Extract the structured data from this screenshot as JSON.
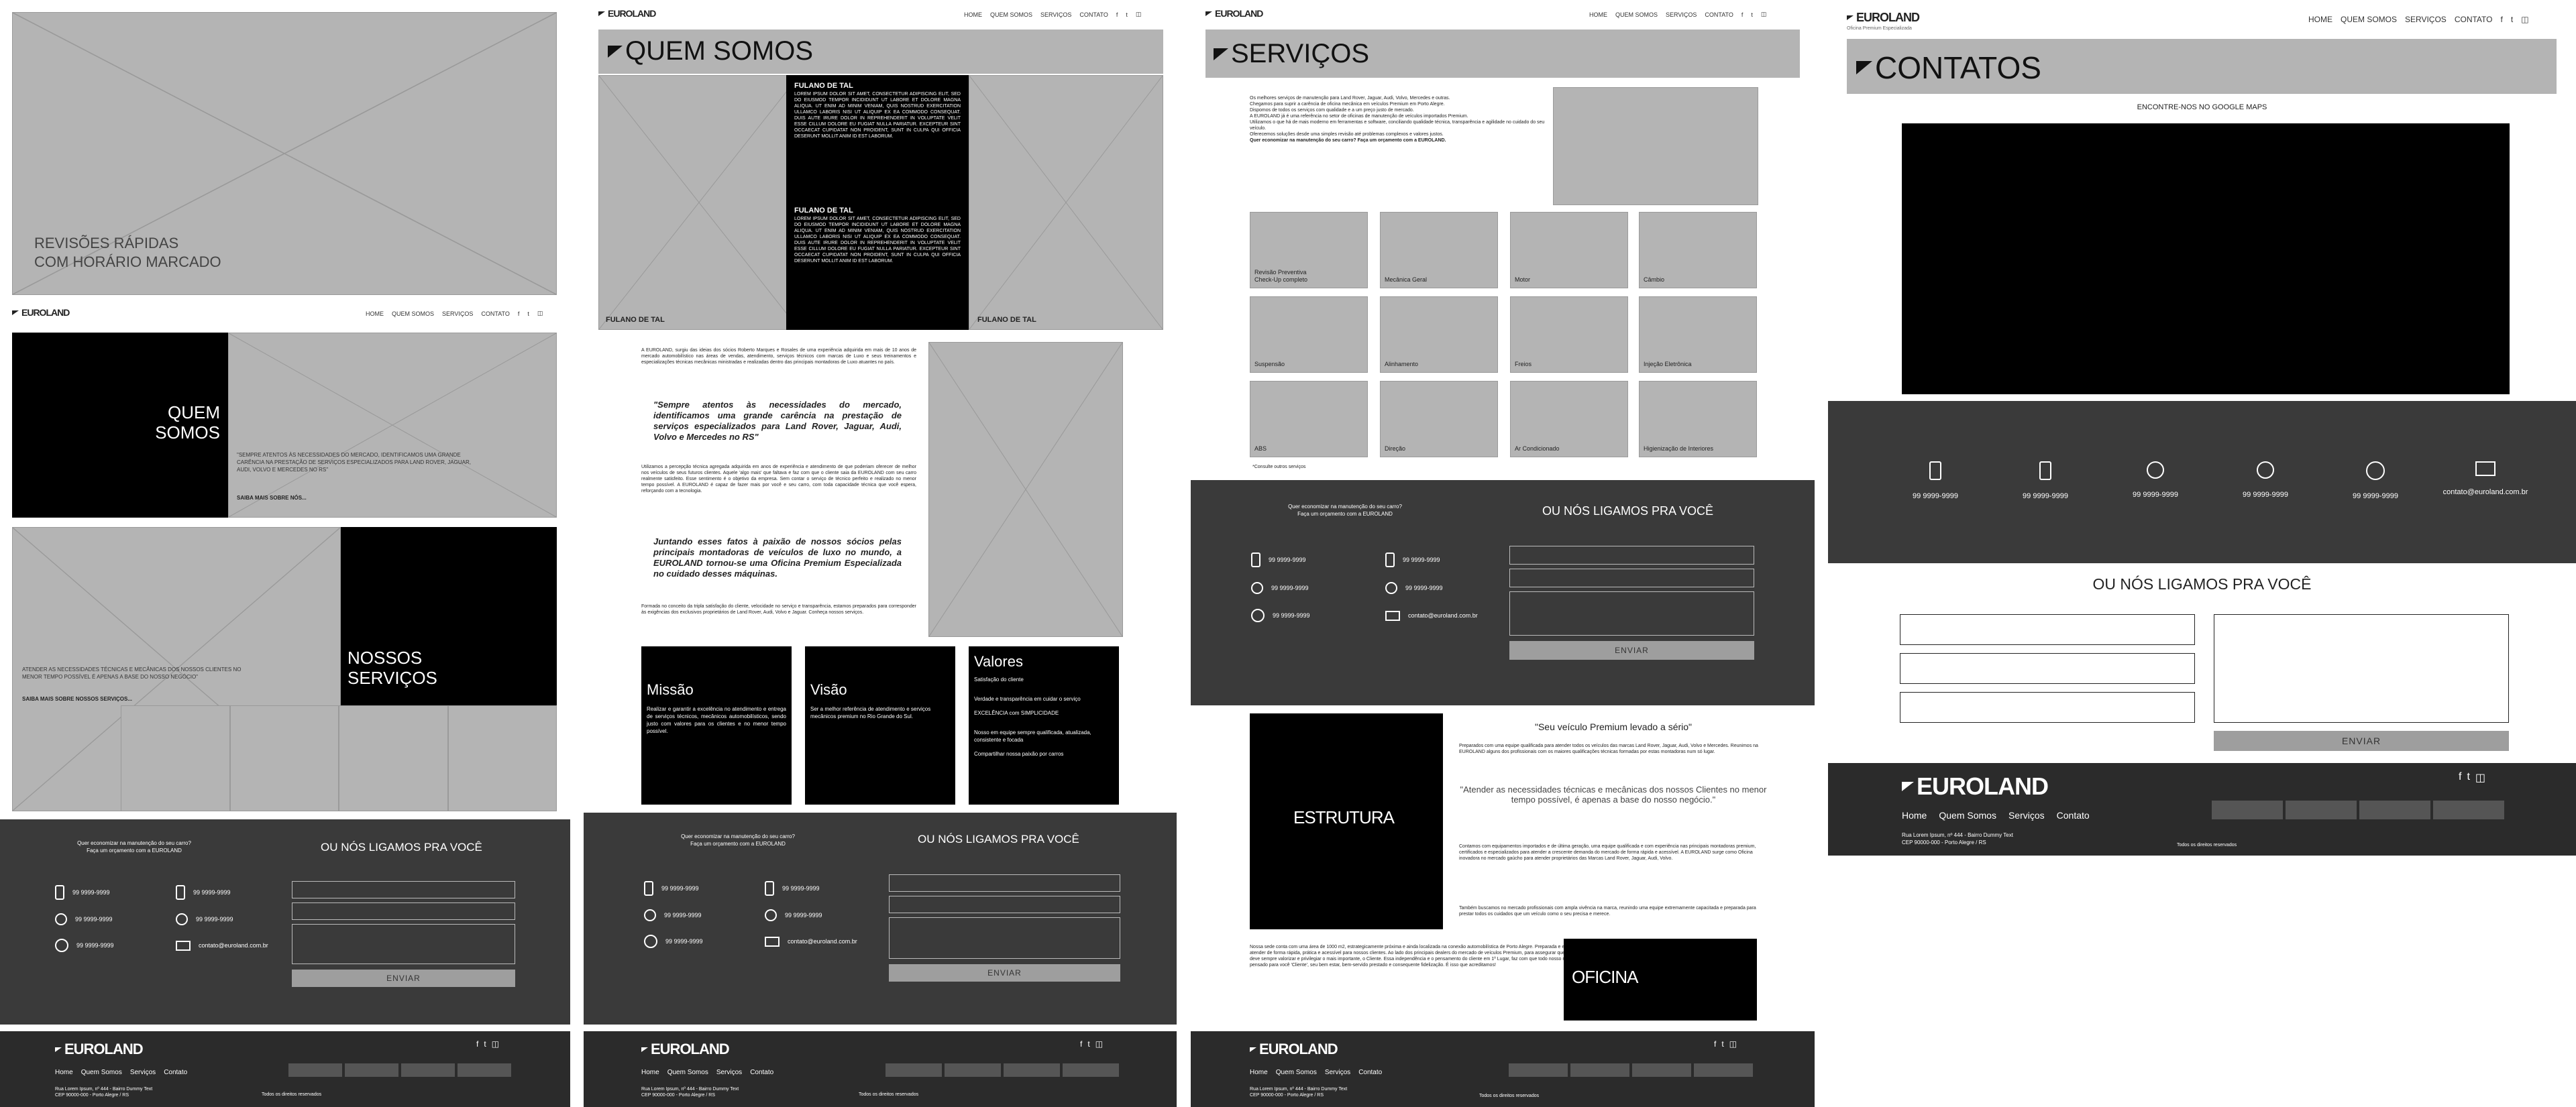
{
  "brand": {
    "name": "EUROLAND",
    "tagline": "Oficina Premium Especializada"
  },
  "nav": {
    "home": "HOME",
    "about": "QUEM SOMOS",
    "services": "SERVIÇOS",
    "contact": "CONTATO"
  },
  "footer_nav": {
    "home": "Home",
    "about": "Quem Somos",
    "services": "Serviços",
    "contact": "Contato"
  },
  "footer": {
    "address1": "Rua Lorem Ipsum, nº 444 - Bairro Dummy Text",
    "address2": "CEP 90000-000 - Porto Alegre / RS",
    "rights": "Todos os direitos reservados"
  },
  "home": {
    "hero_text": "REVISÕES RÁPIDAS\nCOM HORÁRIO MARCADO",
    "about_title": "QUEM\nSOMOS",
    "about_quote": "\"SEMPRE ATENTOS ÀS NECESSIDADES DO MERCADO, IDENTIFICAMOS UMA GRANDE CARÊNCIA NA PRESTAÇÃO DE SERVIÇOS ESPECIALIZADOS PARA LAND ROVER, JAGUAR, AUDI, VOLVO E MERCEDES NO RS\"",
    "about_more": "SAIBA MAIS SOBRE NÓS...",
    "services_title": "NOSSOS\nSERVIÇOS",
    "services_text": "ATENDER AS NECESSIDADES TÉCNICAS E MECÂNICAS DOS NOSSOS CLIENTES NO MENOR TEMPO POSSÍVEL É APENAS A BASE DO NOSSO NEGÓCIO\"",
    "services_more": "SAIBA MAIS SOBRE NOSSOS SERVIÇOS..."
  },
  "callback": {
    "question1": "Quer economizar na manutenção do seu carro?",
    "question2": "Faça um orçamento com a EUROLAND",
    "title": "OU NÓS LIGAMOS PRA VOCÊ",
    "phone": "99 9999-9999",
    "email": "contato@euroland.com.br",
    "send": "ENVIAR"
  },
  "about": {
    "title": "QUEM SOMOS",
    "person_name": "FULANO DE TAL",
    "lorem": "LOREM IPSUM DOLOR SIT AMET, CONSECTETUR ADIPISCING ELIT, SED DO EIUSMOD TEMPOR INCIDIDUNT UT LABORE ET DOLORE MAGNA ALIQUA. UT ENIM AD MINIM VENIAM, QUIS NOSTRUD EXERCITATION ULLAMCO LABORIS NISI UT ALIQUIP EX EA COMMODO CONSEQUAT. DUIS AUTE IRURE DOLOR IN REPREHENDERIT IN VOLUPTATE VELIT ESSE CILLUM DOLORE EU FUGIAT NULLA PARIATUR. EXCEPTEUR SINT OCCAECAT CUPIDATAT NON PROIDENT, SUNT IN CULPA QUI OFFICIA DESERUNT MOLLIT ANIM ID EST LABORUM.",
    "intro": "A EUROLAND, surgiu das ideias dos sócios Roberto Marques e Rosales de uma experiência adquirida em mais de 10 anos de mercado automobilístico nas áreas de vendas, atendimento, serviços técnicos com marcas de Luxo e seus treinamentos e especializações técnicas mecânicas ministradas e realizadas dentro das principais montadoras de Luxo atuantes no país.",
    "quote1": "\"Sempre atentos às necessidades do mercado, identificamos uma grande carência na prestação de serviços especializados para Land Rover, Jaguar, Audi, Volvo e Mercedes no RS\"",
    "body": "Utilizamos a percepção técnica agregada adquirida em anos de experiência e atendimento de que poderiam oferecer de melhor nos veículos de seus futuros clientes. Aquele 'algo mais' que faltava e faz com que o cliente saia da EUROLAND com seu carro realmente satisfeito. Esse sentimento é o objetivo da empresa. Sem contar o serviço de técnico perfeito e realizado no menor tempo possível. A EUROLAND é capaz de fazer mais por você e seu carro, com toda capacidade técnica que você espera, reforçando com a tecnologia.",
    "quote2": "Juntando esses fatos à paixão de nossos sócios pelas principais montadoras de veículos de luxo no mundo, a EUROLAND tornou-se uma Oficina Premium Especializada no cuidado desses máquinas.",
    "closing": "Formada no conceito da tripla satisfação do cliente, velocidade no serviço e transparência, estamos preparados para corresponder às exigências dos exclusivos proprietários de Land Rover, Audi, Volvo e Jaguar. Conheça nossos serviços.",
    "mission_title": "Missão",
    "mission_text": "Realizar e garantir a excelência no atendimento e entrega de serviços técnicos, mecânicos automobilísticos, sendo justo com valores para os clientes e no menor tempo possível.",
    "vision_title": "Visão",
    "vision_text": "Ser a melhor referência de atendimento e serviços mecânicos premium no Rio Grande do Sul.",
    "values_title": "Valores",
    "values": [
      "Satisfação do cliente",
      "Verdade e transparência em cuidar o serviço",
      "EXCELÊNCIA com SIMPLICIDADE",
      "Nosso em equipe sempre qualificada, atualizada, consistente e focada",
      "Compartilhar nossa paixão por carros"
    ]
  },
  "services": {
    "title": "SERVIÇOS",
    "intro": [
      "Os melhores serviços de manutenção para Land Rover, Jaguar, Audi, Volvo, Mercedes e outras.",
      "Chegamos para suprir a carência de oficina mecânica em veículos Premium em Porto Alegre.",
      "Dispomos de todos os serviços com qualidade e a um preço justo de mercado.",
      "A EUROLAND já é uma referência no setor de oficinas de manutenção de veículos importados Premium.",
      "Utilizamos o que há de mais moderno em ferramentas e software, conciliando qualidade técnica, transparência e agilidade no cuidado do seu veículo.",
      "Oferecemos soluções desde uma simples revisão até problemas complexos e valores justos.",
      "Quer economizar na manutenção do seu carro? Faça um orçamento com a EUROLAND."
    ],
    "tiles": [
      "Revisão Preventiva\nCheck-Up completo",
      "Mecânica Geral",
      "Motor",
      "Câmbio",
      "Suspensão",
      "Alinhamento",
      "Freios",
      "Injeção Eletrônica",
      "ABS",
      "Direção",
      "Ar Condicionado",
      "Higienização de Interiores"
    ],
    "note": "*Consulte outros serviços",
    "structure_label": "ESTRUTURA",
    "workshop_label": "OFICINA",
    "quote1": "\"Seu veículo Premium levado a sério\"",
    "text1": "Preparados com uma equipe qualificada para atender todos os veículos das marcas Land Rover, Jaguar, Audi, Volvo e Mercedes. Reunimos na EUROLAND alguns dos profissionais com os maiores qualificações técnicas formadas por estas montadoras num só lugar.",
    "quote2": "\"Atender as necessidades técnicas e mecânicas dos nossos Clientes no menor tempo possível, é apenas a base do nosso negócio.\"",
    "text2": "Contamos com equipamentos importados e de última geração, uma equipe qualificada e com experiência nas principais montadoras premium, certificados e especializados para atender a crescente demanda do mercado de forma rápida e acessível. A EUROLAND surge como Oficina inovadora no mercado gaúcho para atender proprietários das Marcas Land Rover, Jaguar, Audi, Volvo.",
    "text3": "Também buscamos no mercado profissionais com ampla vivência na marca, reunindo uma equipe extremamente capacitada e preparada para prestar todos os cuidados que um veículo como o seu precisa e merece.",
    "text4": "Nossa sede conta com uma área de 1000 m2, estrategicamente próxima e ainda localizada na conexão automobilística de Porto Alegre. Preparada e estruturada para atender de forma rápida, prática e acessível para nossos clientes. Ao lado dos principais dealers do mercado de veículos Premium, para assegurar que a conveniência deve sempre valorizar e privilegiar o mais importante, o Cliente. Essa independência e o pensamento do cliente em 1º Lugar, faz com que todo nosso negócio seja pensado para você 'Cliente', seu bem estar, bem-servido prestado e consequente fidelização. É isso que acreditamos!"
  },
  "contacts": {
    "title": "CONTATOS",
    "map_label": "ENCONTRE-NOS NO GOOGLE MAPS",
    "items": [
      "99 9999-9999",
      "99 9999-9999",
      "99 9999-9999",
      "99 9999-9999",
      "99 9999-9999",
      "contato@euroland.com.br"
    ],
    "callback_title": "OU NÓS LIGAMOS PRA VOCÊ",
    "send": "ENVIAR"
  },
  "colors": {
    "placeholder": "#b4b4b4",
    "dark_band": "#3a3a3a",
    "footer": "#2b2b2b",
    "black": "#000000",
    "button": "#9e9e9e"
  }
}
